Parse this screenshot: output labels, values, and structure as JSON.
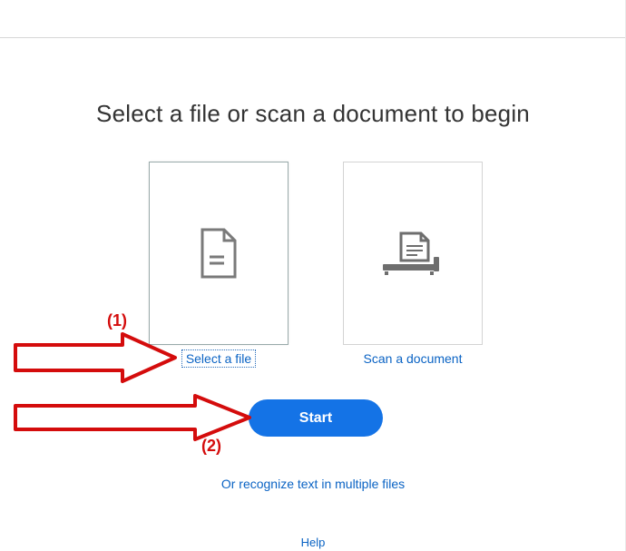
{
  "title": "Select a file or scan a document to begin",
  "options": {
    "file": {
      "label": "Select a file"
    },
    "scan": {
      "label": "Scan a document"
    }
  },
  "start_label": "Start",
  "multi_files_label": "Or recognize text in multiple files",
  "help_label": "Help",
  "annotations": {
    "one": "(1)",
    "two": "(2)"
  }
}
